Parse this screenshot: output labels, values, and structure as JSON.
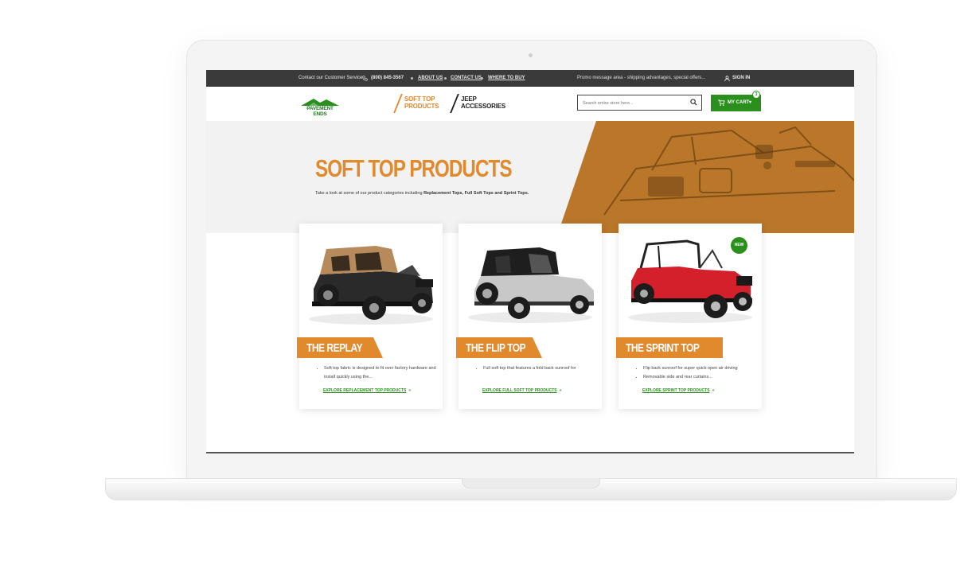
{
  "topbar": {
    "contact_text": "Contact our Customer Service",
    "phone": "(800) 845-3567",
    "links": [
      "ABOUT US",
      "CONTACT US",
      "WHERE TO BUY"
    ],
    "promo": "Promo message area - shipping advantages, special offers...",
    "sign_in": "SIGN IN"
  },
  "header": {
    "logo_text": "PAVEMENT ENDS",
    "nav": [
      {
        "label": "SOFT TOP\nPRODUCTS",
        "color": "#e0892d",
        "active": true
      },
      {
        "label": "JEEP\nACCESSORIES",
        "color": "#222222",
        "active": false
      }
    ],
    "search": {
      "placeholder": "Search entire store here..."
    },
    "cart": {
      "label": "MY CART",
      "count": "3"
    }
  },
  "hero": {
    "title": "SOFT TOP PRODUCTS",
    "desc_prefix": "Take a look at some of our product categories including ",
    "desc_bold": "Replacement Tops, Full Soft Tops and Sprint Tops."
  },
  "cards": [
    {
      "title": "THE REPLAY",
      "bullets": [
        "Soft top fabric is designed to fit over factory hardware and install quickly using the..."
      ],
      "link": "EXPLORE REPLACEMENT TOP PRODUCTS",
      "badge": ""
    },
    {
      "title": "THE FLIP TOP",
      "bullets": [
        "Full soft top that features a fold back sunroof for"
      ],
      "link": "EXPLORE FULL SOFT TOP PRODUCTS",
      "badge": ""
    },
    {
      "title": "THE SPRINT TOP",
      "bullets": [
        "Flip back sunroof for super quick open air driving",
        "Removable side and rear curtains..."
      ],
      "link": "EXPLORE SPRINT TOP PRODUCTS",
      "badge": "NEW"
    }
  ],
  "colors": {
    "accent_orange": "#e0892d",
    "brand_green": "#2b8f1e",
    "topbar_bg": "#3a3a3a"
  }
}
